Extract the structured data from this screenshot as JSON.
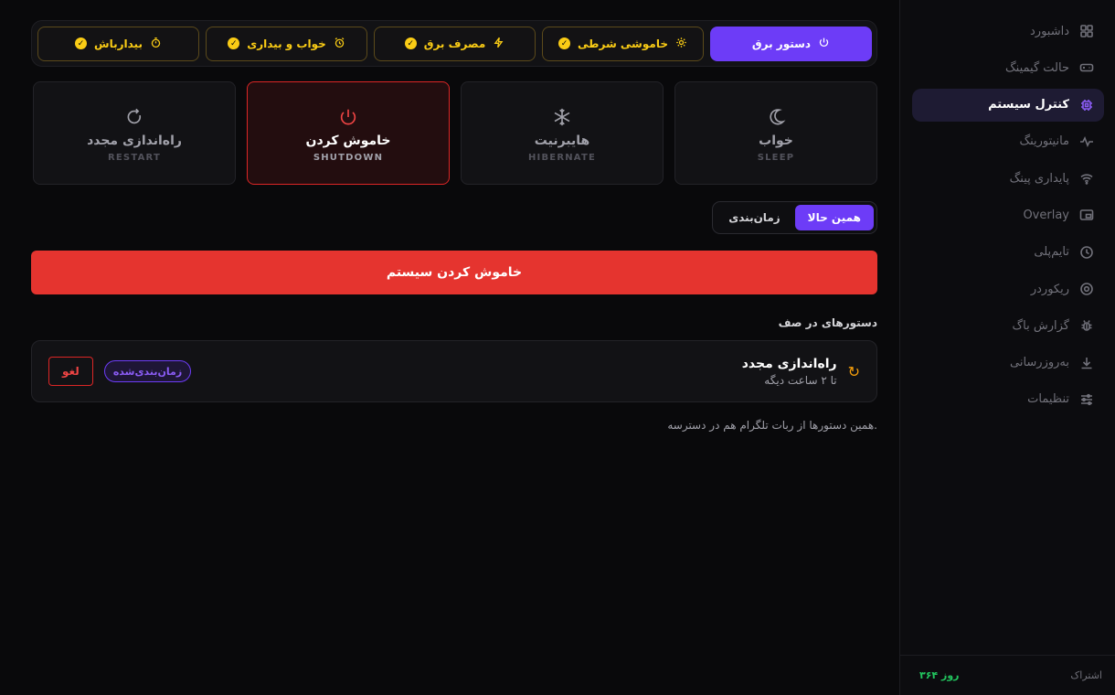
{
  "sidebar": {
    "items": [
      {
        "label": "داشبورد",
        "icon": "grid-icon",
        "active": false
      },
      {
        "label": "حالت گیمینگ",
        "icon": "gamepad-icon",
        "active": false
      },
      {
        "label": "کنترل سیستم",
        "icon": "chip-icon",
        "active": true
      },
      {
        "label": "مانیتورینگ",
        "icon": "pulse-icon",
        "active": false
      },
      {
        "label": "پایداری پینگ",
        "icon": "wifi-icon",
        "active": false
      },
      {
        "label": "Overlay",
        "icon": "overlay-icon",
        "active": false
      },
      {
        "label": "تایم‌پلی",
        "icon": "clock-icon",
        "active": false
      },
      {
        "label": "ریکوردر",
        "icon": "record-icon",
        "active": false
      },
      {
        "label": "گزارش باگ",
        "icon": "bug-icon",
        "active": false
      },
      {
        "label": "به‌روزرسانی",
        "icon": "download-icon",
        "active": false
      },
      {
        "label": "تنظیمات",
        "icon": "sliders-icon",
        "active": false
      }
    ],
    "subscription": {
      "label": "اشتراک",
      "value": "۳۶۴ روز"
    }
  },
  "tabs": [
    {
      "label": "دستور برق",
      "icon": "power-icon",
      "active": true
    },
    {
      "label": "خاموشی شرطی",
      "icon": "sun-icon",
      "active": false
    },
    {
      "label": "مصرف برق",
      "icon": "bolt-icon",
      "active": false
    },
    {
      "label": "خواب و بیداری",
      "icon": "alarm-icon",
      "active": false
    },
    {
      "label": "بیدارباش",
      "icon": "timer-icon",
      "active": false
    }
  ],
  "actions": [
    {
      "title": "خواب",
      "sub": "SLEEP",
      "icon": "moon-icon",
      "selected": false
    },
    {
      "title": "هایبرنیت",
      "sub": "HIBERNATE",
      "icon": "snowflake-icon",
      "selected": false
    },
    {
      "title": "خاموش کردن",
      "sub": "SHUTDOWN",
      "icon": "power-icon",
      "selected": true
    },
    {
      "title": "راه‌اندازی مجدد",
      "sub": "RESTART",
      "icon": "restart-icon",
      "selected": false
    }
  ],
  "mode": {
    "now": "همین حالا",
    "scheduled": "زمان‌بندی"
  },
  "execute_label": "خاموش کردن سیستم",
  "queue": {
    "title": "دستورهای در صف",
    "items": [
      {
        "title": "راه‌اندازی مجدد",
        "sub": "تا ۲ ساعت دیگه",
        "badge": "زمان‌بندی‌شده",
        "cancel": "لغو"
      }
    ]
  },
  "note": "همین دستورها از ربات تلگرام هم در دسترسه.",
  "colors": {
    "accent": "#6d3cf7",
    "danger": "#e5342f",
    "warning": "#facc15",
    "success": "#22c55e"
  }
}
